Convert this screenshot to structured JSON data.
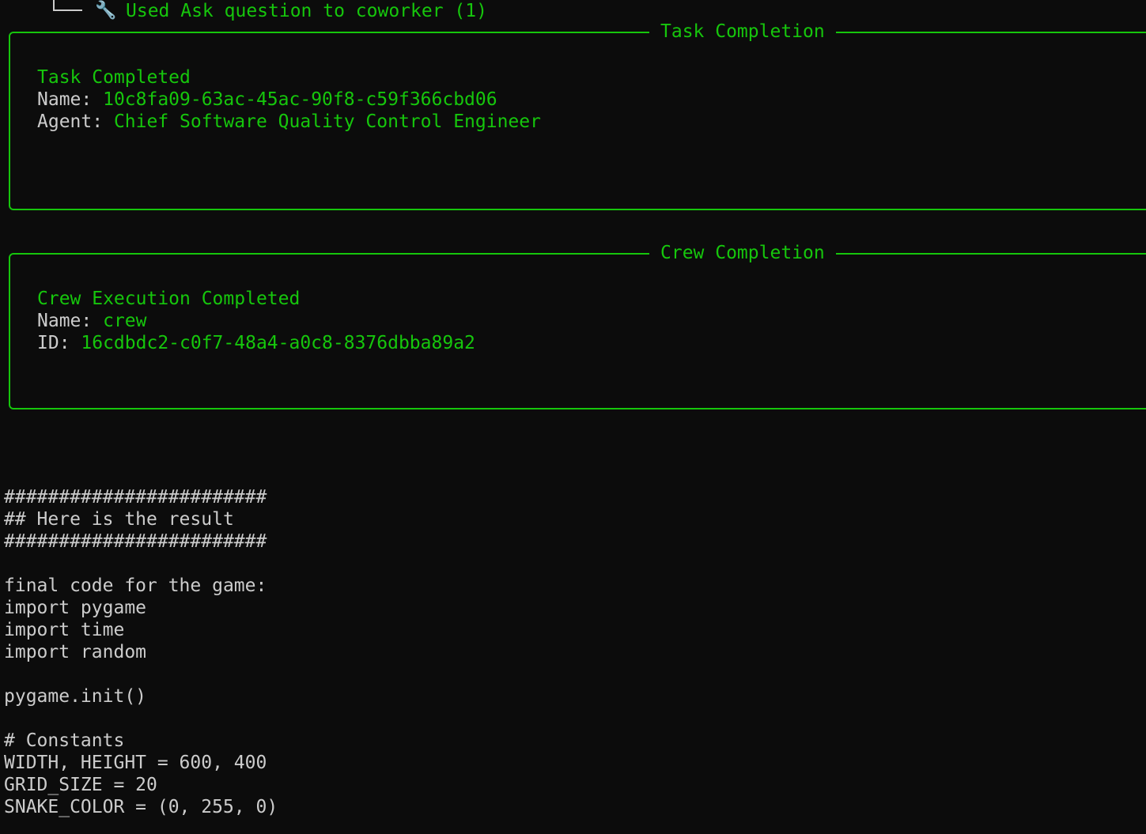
{
  "tool_usage": {
    "icon": "wrench-icon",
    "text": "Used Ask question to coworker (1)"
  },
  "task_panel": {
    "title": "Task Completion",
    "heading": "Task Completed",
    "name_label": "Name: ",
    "name_value": "10c8fa09-63ac-45ac-90f8-c59f366cbd06",
    "agent_label": "Agent: ",
    "agent_value": "Chief Software Quality Control Engineer"
  },
  "crew_panel": {
    "title": "Crew Completion",
    "heading": "Crew Execution Completed",
    "name_label": "Name: ",
    "name_value": "crew",
    "id_label": "ID: ",
    "id_value": "16cdbdc2-c0f7-48a4-a0c8-8376dbba89a2"
  },
  "output_lines": [
    "########################",
    "## Here is the result",
    "########################",
    "",
    "final code for the game:",
    "import pygame",
    "import time",
    "import random",
    "",
    "pygame.init()",
    "",
    "# Constants",
    "WIDTH, HEIGHT = 600, 400",
    "GRID_SIZE = 20",
    "SNAKE_COLOR = (0, 255, 0)"
  ],
  "colors": {
    "background": "#0c0c0c",
    "accent_green": "#16c60c",
    "text": "#cccccc"
  }
}
